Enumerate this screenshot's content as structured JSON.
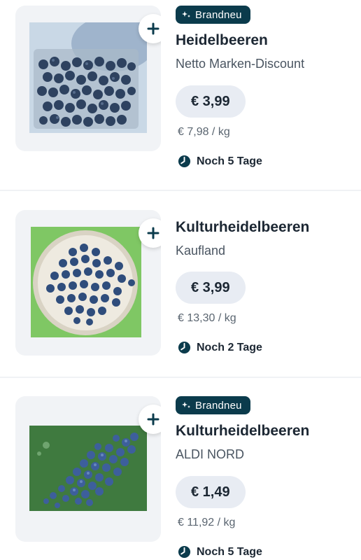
{
  "offers": [
    {
      "badge": "Brandneu",
      "name": "Heidelbeeren",
      "store": "Netto Marken-Discount",
      "price": "€ 3,99",
      "unit_price": "€ 7,98 / kg",
      "validity": "Noch 5 Tage",
      "image": "blueberry-punnet"
    },
    {
      "badge": "",
      "name": "Kulturheidelbeeren",
      "store": "Kaufland",
      "price": "€ 3,99",
      "unit_price": "€ 13,30 / kg",
      "validity": "Noch 2 Tage",
      "image": "blueberries-on-plate"
    },
    {
      "badge": "Brandneu",
      "name": "Kulturheidelbeeren",
      "store": "ALDI NORD",
      "price": "€ 1,49",
      "unit_price": "€ 11,92 / kg",
      "validity": "Noch 5 Tage",
      "image": "blueberries-on-green"
    }
  ],
  "colors": {
    "badge_bg": "#0b3b4c",
    "price_pill_bg": "#e8ecf3",
    "image_card_bg": "#f1f3f6"
  },
  "icons": [
    "plus-icon",
    "sparkle-icon",
    "clock-icon"
  ]
}
